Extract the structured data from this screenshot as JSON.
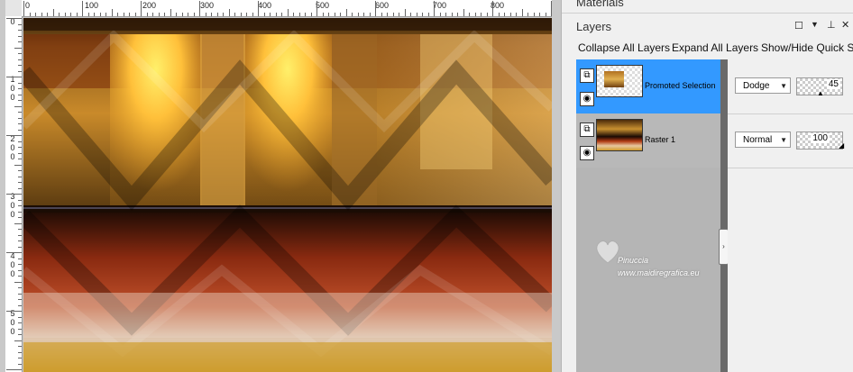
{
  "ruler": {
    "h_labels": [
      "0",
      "100",
      "200",
      "300",
      "400",
      "500",
      "600",
      "700",
      "800"
    ],
    "v_labels": [
      [
        "0"
      ],
      [
        "1",
        "0",
        "0"
      ],
      [
        "2",
        "0",
        "0"
      ],
      [
        "3",
        "0",
        "0"
      ],
      [
        "4",
        "0",
        "0"
      ],
      [
        "5",
        "0",
        "0"
      ]
    ]
  },
  "materials_panel": {
    "title": "Materials"
  },
  "layers_panel": {
    "title": "Layers",
    "toolbar": {
      "collapse": "Collapse All Layers",
      "expand": "Expand All Layers",
      "show_hide": "Show/Hide Quick Se"
    },
    "layers": [
      {
        "name": "Promoted Selection",
        "blend_mode": "Dodge",
        "opacity": "45",
        "selected": true
      },
      {
        "name": "Raster 1",
        "blend_mode": "Normal",
        "opacity": "100",
        "selected": false
      }
    ]
  },
  "watermark": {
    "line1": "Pinuccia",
    "line2": "www.maidiregrafica.eu"
  },
  "colors": {
    "selection": "#3399ff",
    "panel_bg": "#f0f0f0",
    "scrollbar": "#6a6a6a"
  },
  "icons": {
    "window_restore": "square-icon",
    "dropdown": "chevron-down-icon",
    "pin": "pin-icon",
    "close": "close-icon",
    "eye": "eye-icon",
    "layer_group": "layer-stack-icon"
  }
}
